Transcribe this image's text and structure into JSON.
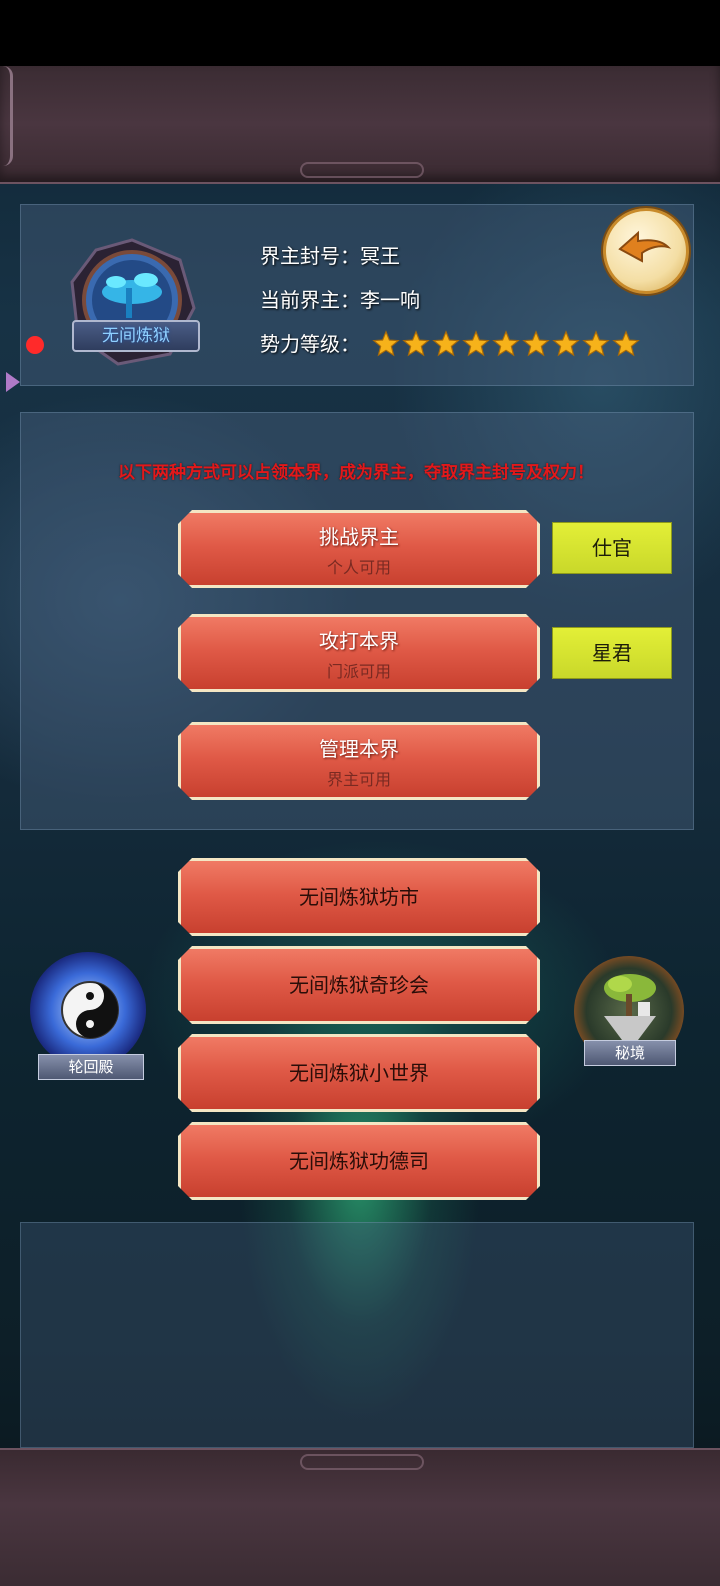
{
  "realm": {
    "emblem_label": "无间炼狱",
    "title_label": "界主封号：",
    "title_value": "冥王",
    "lord_label": "当前界主：",
    "lord_value": "李一响",
    "power_label": "势力等级：",
    "power_stars": 9
  },
  "notice": "以下两种方式可以占领本界，成为界主，夺取界主封号及权力！",
  "actions": [
    {
      "label": "挑战界主",
      "sub": "个人可用",
      "rank": "仕官"
    },
    {
      "label": "攻打本界",
      "sub": "门派可用",
      "rank": "星君"
    },
    {
      "label": "管理本界",
      "sub": "界主可用"
    }
  ],
  "menu": [
    {
      "label": "无间炼狱坊市"
    },
    {
      "label": "无间炼狱奇珍会"
    },
    {
      "label": "无间炼狱小世界"
    },
    {
      "label": "无间炼狱功德司"
    }
  ],
  "side": {
    "left_label": "轮回殿",
    "right_label": "秘境"
  },
  "icons": {
    "back": "back-arrow-icon",
    "star": "star-icon",
    "left_portal": "yin-yang-icon",
    "right_portal": "floating-island-icon"
  },
  "colors": {
    "notice": "#e3181a",
    "button": "#e05a47",
    "rank_button": "#e3ef37",
    "star": "#f6b21a"
  }
}
